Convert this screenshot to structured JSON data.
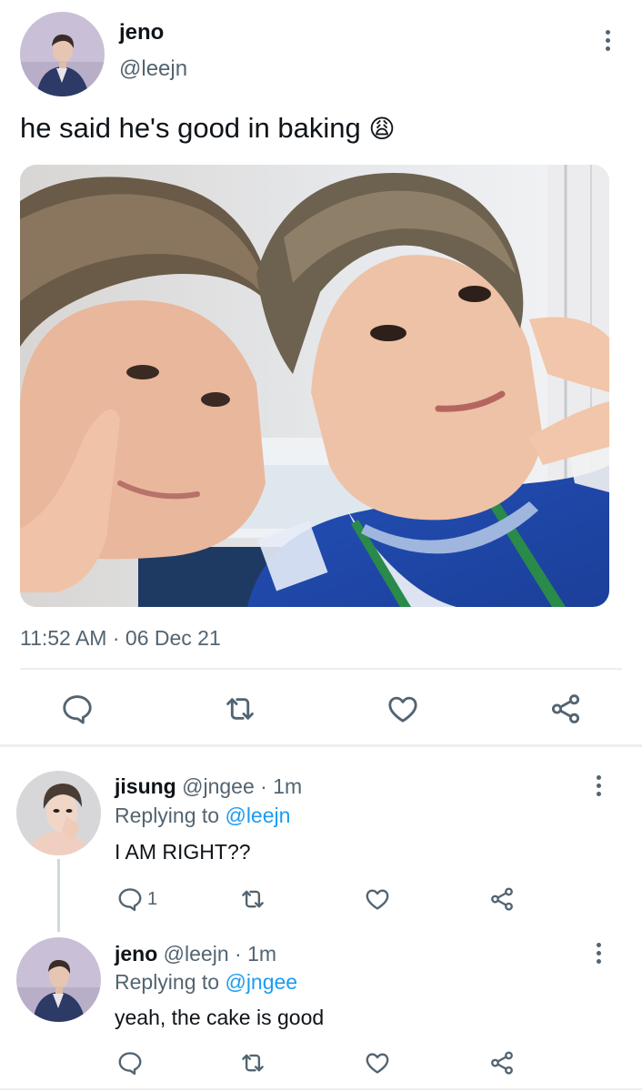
{
  "main_tweet": {
    "author_name": "jeno",
    "author_handle": "@leejn",
    "text": "he said he's good in baking",
    "emoji": "😩",
    "timestamp": "11:52 AM · 06 Dec 21"
  },
  "replies": [
    {
      "author_name": "jisung",
      "author_handle": "@jngee",
      "sep": "·",
      "age": "1m",
      "replying_prefix": "Replying to",
      "replying_handle": "@leejn",
      "text": "I AM RIGHT??",
      "reply_count": "1"
    },
    {
      "author_name": "jeno",
      "author_handle": "@leejn",
      "sep": "·",
      "age": "1m",
      "replying_prefix": "Replying to",
      "replying_handle": "@jngee",
      "text": "yeah, the cake is good",
      "reply_count": ""
    }
  ],
  "icons": {
    "reply": "speech-bubble-icon",
    "retweet": "retweet-icon",
    "like": "heart-icon",
    "share": "share-nodes-icon",
    "more": "vertical-dots-icon"
  },
  "colors": {
    "text": "#0f1419",
    "muted": "#536471",
    "link": "#1d9bf0",
    "divider": "#eceef0"
  }
}
